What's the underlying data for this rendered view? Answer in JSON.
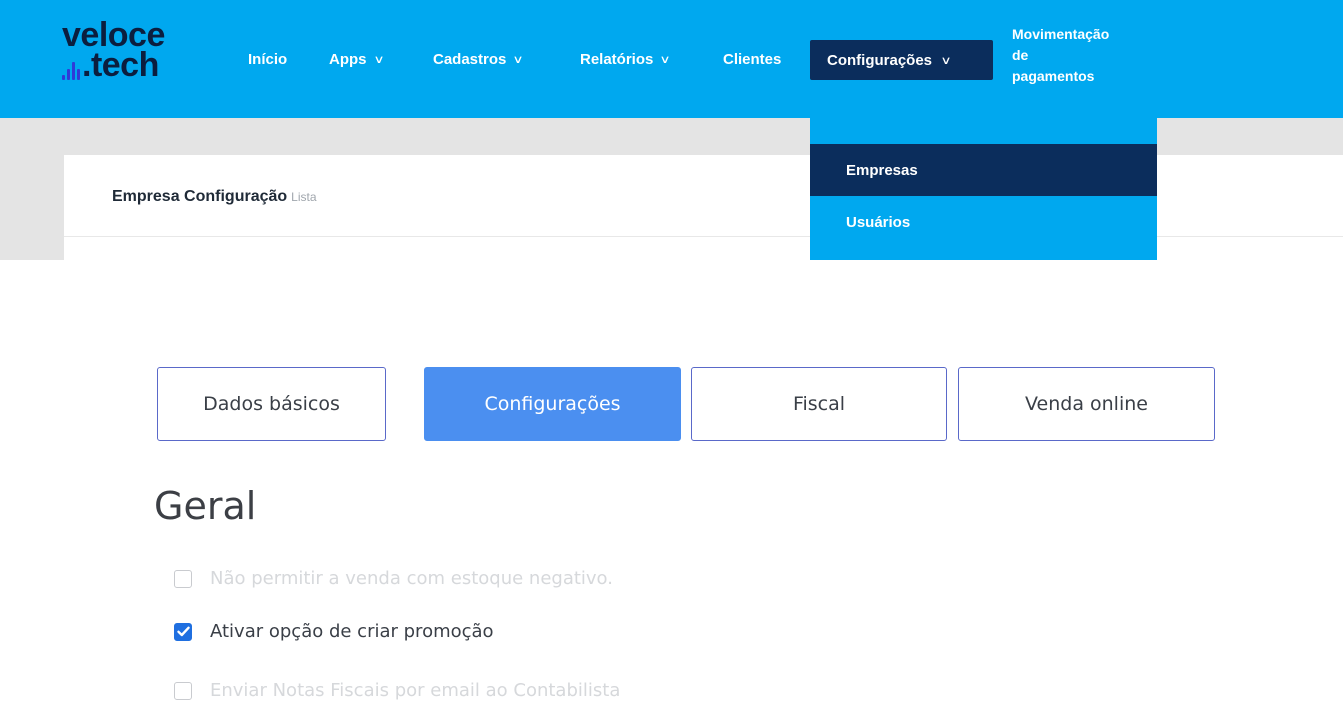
{
  "logo": {
    "line1": "veloce",
    "line2": ".tech"
  },
  "nav": {
    "items": [
      {
        "label": "Início",
        "dropdown": false
      },
      {
        "label": "Apps",
        "dropdown": true
      },
      {
        "label": "Cadastros",
        "dropdown": true
      },
      {
        "label": "Relatórios",
        "dropdown": true
      },
      {
        "label": "Clientes",
        "dropdown": false
      }
    ],
    "active": {
      "label": "Configurações",
      "dropdown": true
    },
    "multi": [
      "Movimentação",
      "de",
      "pagamentos"
    ]
  },
  "card": {
    "title": "Empresa Configuração",
    "subtitle": "Lista"
  },
  "dropdown": {
    "items": [
      {
        "label": "Empresas",
        "active": true
      },
      {
        "label": "Usuários",
        "active": false
      }
    ]
  },
  "tabs": [
    {
      "label": "Dados básicos",
      "active": false
    },
    {
      "label": "Configurações",
      "active": true
    },
    {
      "label": "Fiscal",
      "active": false
    },
    {
      "label": "Venda online",
      "active": false
    }
  ],
  "section": {
    "title": "Geral"
  },
  "options": [
    {
      "label": "Não permitir a venda com estoque negativo.",
      "checked": false,
      "faded": true
    },
    {
      "label": "Ativar opção de criar promoção",
      "checked": true,
      "faded": false
    },
    {
      "label": "Enviar Notas Fiscais por email ao Contabilista",
      "checked": false,
      "faded": true
    }
  ],
  "colors": {
    "navbar": "#00a8ef",
    "active_nav": "#0b2d5c",
    "tab_active": "#4b8ff0",
    "checkbox": "#1f6fe0"
  },
  "icons": {
    "chevron": "chevron-down-icon",
    "check": "check-icon"
  }
}
